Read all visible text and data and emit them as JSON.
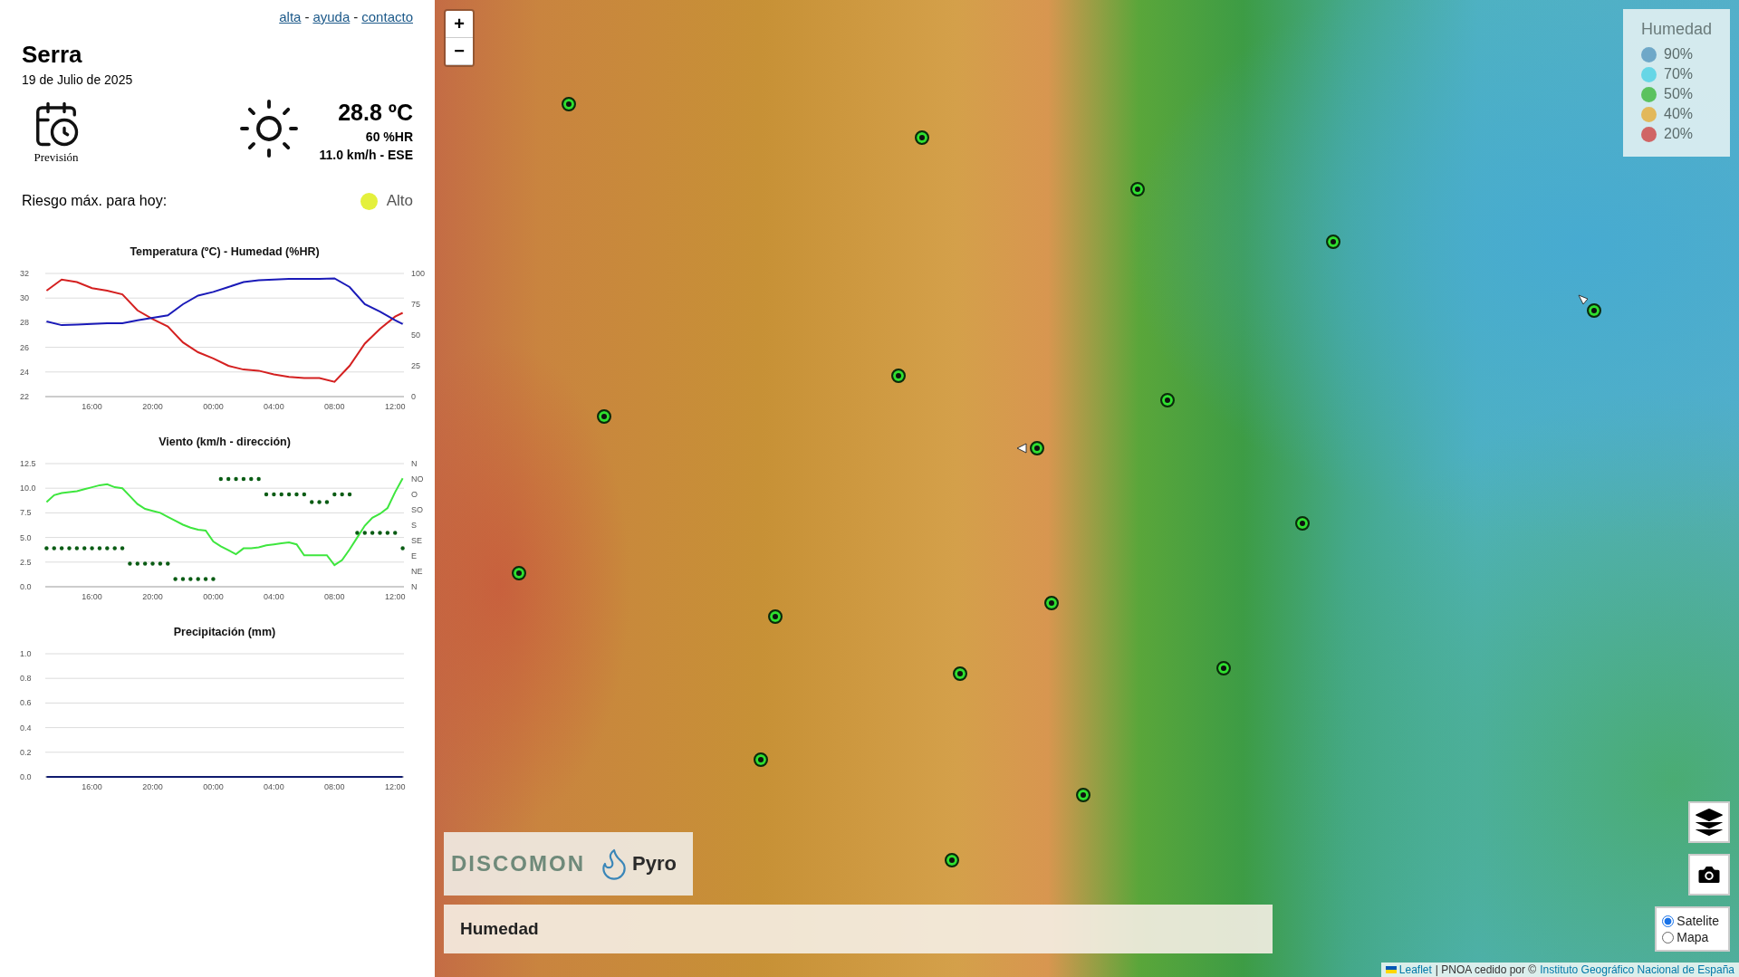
{
  "links": {
    "items": [
      "alta",
      "ayuda",
      "contacto"
    ],
    "separator": "-"
  },
  "location": {
    "name": "Serra",
    "date": "19 de Julio de 2025"
  },
  "forecast": {
    "label": "Previsión"
  },
  "current": {
    "temperature": "28.8 ºC",
    "humidity": "60 %HR",
    "wind": "11.0 km/h - ESE"
  },
  "risk": {
    "label": "Riesgo máx. para hoy:",
    "value": "Alto",
    "color": "#e4f03c"
  },
  "charts": [
    {
      "chart_data": {
        "type": "line",
        "title": "Temperatura (ºC) - Humedad (%HR)",
        "x": [
          "2025-07-19T13:00",
          "2025-07-19T14:00",
          "2025-07-19T15:00",
          "2025-07-19T16:00",
          "2025-07-19T17:00",
          "2025-07-19T18:00",
          "2025-07-19T19:00",
          "2025-07-19T20:00",
          "2025-07-19T21:00",
          "2025-07-19T22:00",
          "2025-07-19T23:00",
          "2025-07-20T00:00",
          "2025-07-20T01:00",
          "2025-07-20T02:00",
          "2025-07-20T03:00",
          "2025-07-20T04:00",
          "2025-07-20T05:00",
          "2025-07-20T06:00",
          "2025-07-20T07:00",
          "2025-07-20T08:00",
          "2025-07-20T09:00",
          "2025-07-20T10:00",
          "2025-07-20T11:00",
          "2025-07-20T12:00",
          "2025-07-20T12:30"
        ],
        "xticks": [
          {
            "value": "2025-07-19T16:00",
            "label": "16:00"
          },
          {
            "value": "2025-07-19T20:00",
            "label": "20:00"
          },
          {
            "value": "2025-07-20T00:00",
            "label": "00:00"
          },
          {
            "value": "2025-07-20T04:00",
            "label": "04:00"
          },
          {
            "value": "2025-07-20T08:00",
            "label": "08:00"
          },
          {
            "value": "2025-07-20T12:00",
            "label": "12:00"
          }
        ],
        "xlim": [
          "2025-07-19T12:55",
          "2025-07-20T12:35"
        ],
        "grid": true,
        "ylim": [
          22,
          32
        ],
        "yticks": [
          22,
          24,
          26,
          28,
          30,
          32
        ],
        "y2lim": [
          0,
          100
        ],
        "y2ticks": [
          0,
          25,
          50,
          75,
          100
        ],
        "series": [
          {
            "color": "#d42020",
            "values": [
              30.6,
              31.5,
              31.3,
              30.8,
              30.6,
              30.3,
              29.0,
              28.3,
              27.7,
              26.4,
              25.6,
              25.1,
              24.5,
              24.2,
              24.1,
              23.8,
              23.6,
              23.5,
              23.5,
              23.2,
              24.5,
              26.3,
              27.5,
              28.5,
              28.8
            ]
          },
          {
            "color": "#1a1ab8",
            "axis": "y2",
            "values": [
              61,
              58,
              58.5,
              59,
              59.5,
              59.5,
              62,
              64,
              66,
              75,
              82,
              85,
              89,
              93,
              94.5,
              95,
              95.5,
              95.5,
              95.5,
              96,
              89,
              75,
              69,
              62,
              59
            ]
          }
        ]
      }
    },
    {
      "chart_data": {
        "type": "line",
        "title": "Viento (km/h - dirección)",
        "x": [
          "2025-07-19T13:00",
          "2025-07-19T13:30",
          "2025-07-19T14:00",
          "2025-07-19T14:30",
          "2025-07-19T15:00",
          "2025-07-19T15:30",
          "2025-07-19T16:00",
          "2025-07-19T16:30",
          "2025-07-19T17:00",
          "2025-07-19T17:30",
          "2025-07-19T18:00",
          "2025-07-19T18:30",
          "2025-07-19T19:00",
          "2025-07-19T19:30",
          "2025-07-19T20:00",
          "2025-07-19T20:30",
          "2025-07-19T21:00",
          "2025-07-19T21:30",
          "2025-07-19T22:00",
          "2025-07-19T22:30",
          "2025-07-19T23:00",
          "2025-07-19T23:30",
          "2025-07-20T00:00",
          "2025-07-20T00:30",
          "2025-07-20T01:00",
          "2025-07-20T01:30",
          "2025-07-20T02:00",
          "2025-07-20T02:30",
          "2025-07-20T03:00",
          "2025-07-20T03:30",
          "2025-07-20T04:00",
          "2025-07-20T04:30",
          "2025-07-20T05:00",
          "2025-07-20T05:30",
          "2025-07-20T06:00",
          "2025-07-20T06:30",
          "2025-07-20T07:00",
          "2025-07-20T07:30",
          "2025-07-20T08:00",
          "2025-07-20T08:30",
          "2025-07-20T09:00",
          "2025-07-20T09:30",
          "2025-07-20T10:00",
          "2025-07-20T10:30",
          "2025-07-20T11:00",
          "2025-07-20T11:30",
          "2025-07-20T12:00",
          "2025-07-20T12:30"
        ],
        "xticks": [
          {
            "value": "2025-07-19T16:00",
            "label": "16:00"
          },
          {
            "value": "2025-07-19T20:00",
            "label": "20:00"
          },
          {
            "value": "2025-07-20T00:00",
            "label": "00:00"
          },
          {
            "value": "2025-07-20T04:00",
            "label": "04:00"
          },
          {
            "value": "2025-07-20T08:00",
            "label": "08:00"
          },
          {
            "value": "2025-07-20T12:00",
            "label": "12:00"
          }
        ],
        "xlim": [
          "2025-07-19T12:55",
          "2025-07-20T12:35"
        ],
        "grid": true,
        "ylim": [
          0,
          12.5
        ],
        "yticks": [
          {
            "value": 0,
            "label": "0.0"
          },
          {
            "value": 2.5,
            "label": "2.5"
          },
          {
            "value": 5,
            "label": "5.0"
          },
          {
            "value": 7.5,
            "label": "7.5"
          },
          {
            "value": 10,
            "label": "10.0"
          },
          {
            "value": 12.5,
            "label": "12.5"
          }
        ],
        "series": [
          {
            "color": "#3ee63e",
            "values": [
              8.6,
              9.3,
              9.5,
              9.6,
              9.7,
              9.9,
              10.1,
              10.3,
              10.4,
              10.1,
              10.0,
              9.2,
              8.4,
              7.9,
              7.7,
              7.5,
              7.1,
              6.7,
              6.3,
              6.0,
              5.8,
              5.7,
              4.6,
              4.1,
              3.7,
              3.3,
              3.9,
              3.9,
              4.0,
              4.2,
              4.3,
              4.4,
              4.5,
              4.3,
              3.2,
              3.2,
              3.2,
              3.2,
              2.2,
              2.7,
              3.8,
              5.0,
              6.2,
              7.0,
              7.4,
              8.0,
              9.6,
              11.0
            ]
          }
        ]
      },
      "direction_labels": [
        "N",
        "NO",
        "O",
        "SO",
        "S",
        "SE",
        "E",
        "NE",
        "N"
      ]
    },
    {
      "chart_data": {
        "type": "line",
        "title": "Precipitación (mm)",
        "x": [
          "2025-07-19T13:00",
          "2025-07-19T14:00",
          "2025-07-19T15:00",
          "2025-07-19T16:00",
          "2025-07-19T17:00",
          "2025-07-19T18:00",
          "2025-07-19T19:00",
          "2025-07-19T20:00",
          "2025-07-19T21:00",
          "2025-07-19T22:00",
          "2025-07-19T23:00",
          "2025-07-20T00:00",
          "2025-07-20T01:00",
          "2025-07-20T02:00",
          "2025-07-20T03:00",
          "2025-07-20T04:00",
          "2025-07-20T05:00",
          "2025-07-20T06:00",
          "2025-07-20T07:00",
          "2025-07-20T08:00",
          "2025-07-20T09:00",
          "2025-07-20T10:00",
          "2025-07-20T11:00",
          "2025-07-20T12:00",
          "2025-07-20T12:30"
        ],
        "xticks": [
          {
            "value": "2025-07-19T16:00",
            "label": "16:00"
          },
          {
            "value": "2025-07-19T20:00",
            "label": "20:00"
          },
          {
            "value": "2025-07-20T00:00",
            "label": "00:00"
          },
          {
            "value": "2025-07-20T04:00",
            "label": "04:00"
          },
          {
            "value": "2025-07-20T08:00",
            "label": "08:00"
          },
          {
            "value": "2025-07-20T12:00",
            "label": "12:00"
          }
        ],
        "xlim": [
          "2025-07-19T12:55",
          "2025-07-20T12:35"
        ],
        "grid": true,
        "ylim": [
          0,
          1
        ],
        "yticks": [
          {
            "value": 0,
            "label": "0.0"
          },
          {
            "value": 0.2,
            "label": "0.2"
          },
          {
            "value": 0.4,
            "label": "0.4"
          },
          {
            "value": 0.6,
            "label": "0.6"
          },
          {
            "value": 0.8,
            "label": "0.8"
          },
          {
            "value": 1,
            "label": "1.0"
          }
        ],
        "series": [
          {
            "color": "#0f1a6e",
            "values": [
              0,
              0,
              0,
              0,
              0,
              0,
              0,
              0,
              0,
              0,
              0,
              0,
              0,
              0,
              0,
              0,
              0,
              0,
              0,
              0,
              0,
              0,
              0,
              0,
              0
            ]
          }
        ]
      }
    }
  ],
  "map": {
    "zoom_in": "+",
    "zoom_out": "−",
    "legend": {
      "title": "Humedad",
      "items": [
        {
          "label": "90%",
          "color": "#6fa8c8"
        },
        {
          "label": "70%",
          "color": "#66d6e6"
        },
        {
          "label": "50%",
          "color": "#5bc25f"
        },
        {
          "label": "40%",
          "color": "#e2b85a"
        },
        {
          "label": "20%",
          "color": "#d06565"
        }
      ]
    },
    "logo": {
      "brand": "DISCOMON",
      "product": "Pyro"
    },
    "layer_title": "Humedad",
    "base_layers": [
      {
        "label": "Satelite",
        "selected": true
      },
      {
        "label": "Mapa",
        "selected": false
      }
    ],
    "attribution": {
      "leaflet": "Leaflet",
      "text": "| PNOA cedido por ©",
      "source": "Instituto Geográfico Nacional de España"
    }
  }
}
